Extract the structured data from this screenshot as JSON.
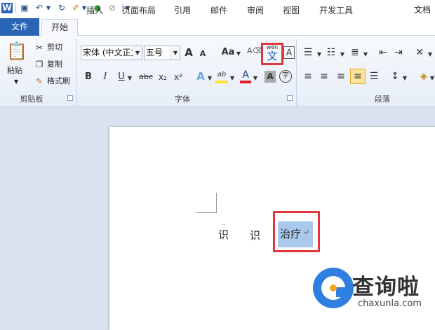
{
  "window": {
    "title": "文档"
  },
  "quick_access": {
    "icons": [
      "word-app-icon",
      "save-icon",
      "undo-icon",
      "redo-icon",
      "format-painter-qa-icon",
      "color-icon",
      "eraser-icon",
      "customize-icon"
    ]
  },
  "tabs": {
    "file": "文件",
    "items": [
      "开始",
      "插入",
      "页面布局",
      "引用",
      "邮件",
      "审阅",
      "视图",
      "开发工具"
    ]
  },
  "clipboard": {
    "paste": "粘贴",
    "cut": "剪切",
    "copy": "复制",
    "format_painter": "格式刷",
    "label": "剪贴板"
  },
  "font": {
    "name": "宋体 (中文正文)",
    "size": "五号",
    "label": "字体",
    "aa": "Aa",
    "grow": "A",
    "shrink": "A",
    "bold": "B",
    "italic": "I",
    "underline": "U",
    "strike": "abc",
    "sub": "x₂",
    "sup": "x²",
    "phonetic_small": "wén",
    "phonetic_big": "文",
    "border_a": "A",
    "color_a": "A",
    "shade_a": "A",
    "enclose": "字",
    "effects_a": "A",
    "highlight": "ab"
  },
  "paragraph": {
    "label": "段落"
  },
  "document": {
    "char1": "识",
    "char2": "识",
    "selected_text": "治疗",
    "para_mark": "↵"
  },
  "watermark": {
    "name": "查询啦",
    "url": "chaxunla.com"
  },
  "colors": {
    "file_tab": "#2a64b6",
    "highlight": "#a8c8ec",
    "red_box": "#e0373f",
    "logo_blue": "#2e7fe0"
  }
}
